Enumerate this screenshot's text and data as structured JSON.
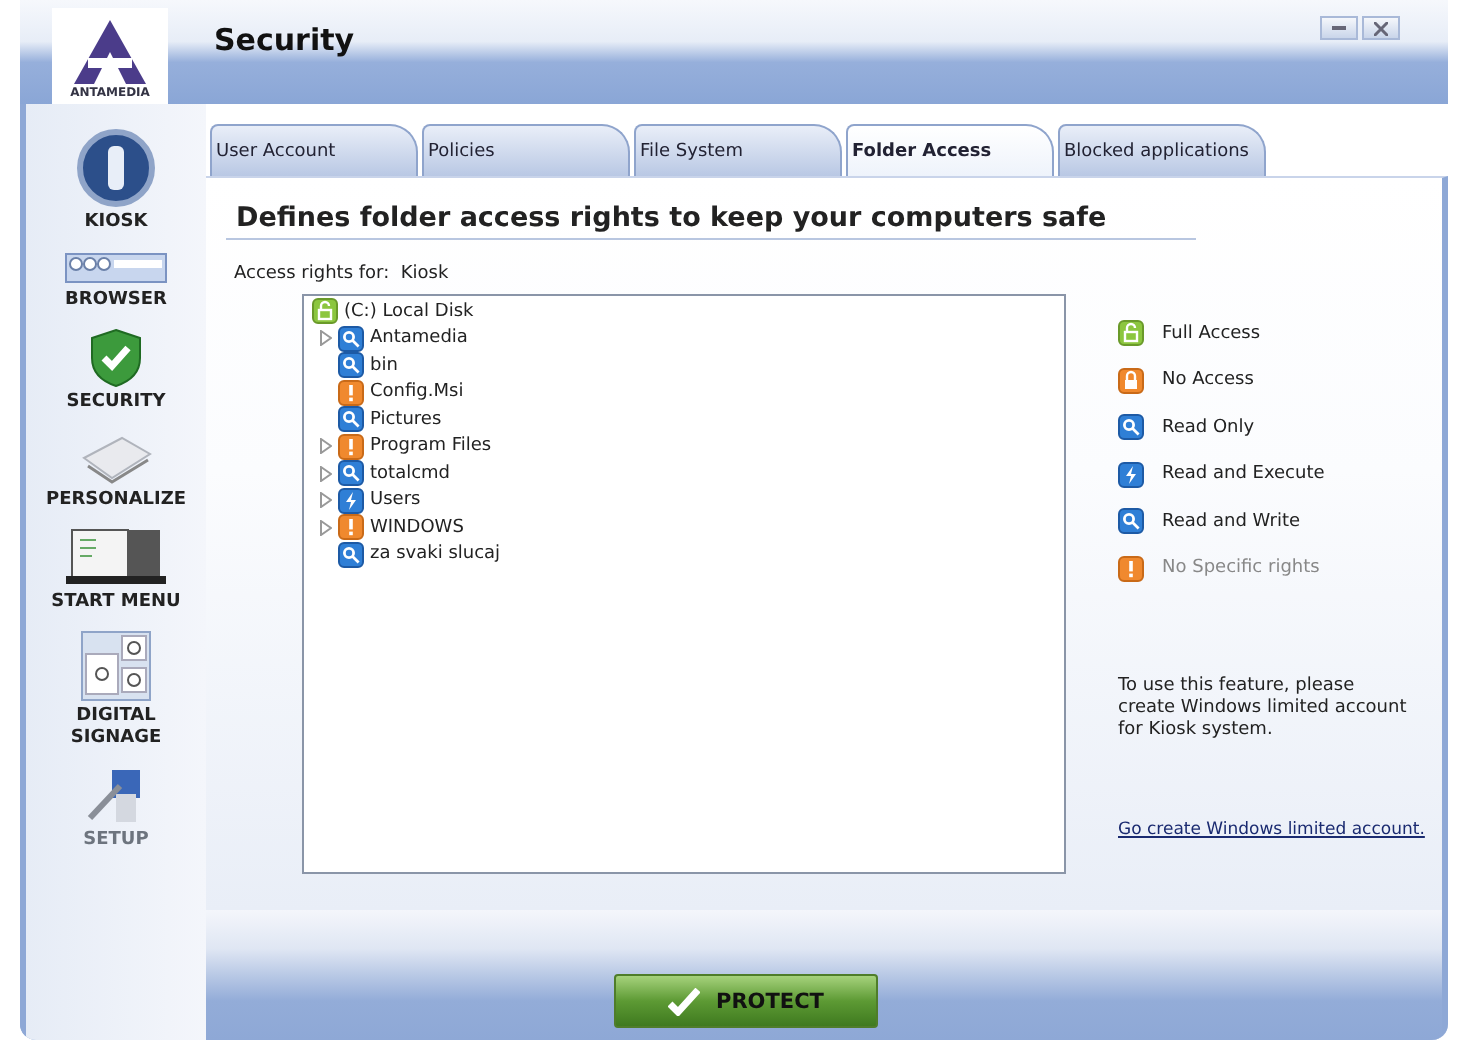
{
  "window": {
    "logo": "ANTAMEDIA",
    "title": "Security"
  },
  "sidebar": {
    "items": [
      {
        "label": "KIOSK",
        "kind": "kiosk",
        "disabled": false
      },
      {
        "label": "BROWSER",
        "kind": "browser",
        "disabled": false
      },
      {
        "label": "SECURITY",
        "kind": "shield",
        "disabled": false
      },
      {
        "label": "PERSONALIZE",
        "kind": "paper",
        "disabled": false
      },
      {
        "label": "START MENU",
        "kind": "monitor",
        "disabled": false
      },
      {
        "label": "DIGITAL SIGNAGE",
        "kind": "signage",
        "disabled": false
      },
      {
        "label": "SETUP",
        "kind": "setup",
        "disabled": true
      }
    ]
  },
  "tabs": [
    {
      "label": "User Account",
      "selected": false
    },
    {
      "label": "Policies",
      "selected": false
    },
    {
      "label": "File System",
      "selected": false
    },
    {
      "label": "Folder Access",
      "selected": true
    },
    {
      "label": "Blocked applications",
      "selected": false
    }
  ],
  "heading": "Defines folder access rights to keep your computers safe",
  "access_for": {
    "label": "Access rights for:",
    "value": "Kiosk"
  },
  "tree": {
    "label": "(C:) Local Disk",
    "kind": "full",
    "children": [
      {
        "label": "Antamedia",
        "kind": "read",
        "expandable": true
      },
      {
        "label": "bin",
        "kind": "read",
        "expandable": false
      },
      {
        "label": "Config.Msi",
        "kind": "unspecified",
        "expandable": false
      },
      {
        "label": "Pictures",
        "kind": "read",
        "expandable": false
      },
      {
        "label": "Program Files",
        "kind": "unspecified",
        "expandable": true
      },
      {
        "label": "totalcmd",
        "kind": "read",
        "expandable": true
      },
      {
        "label": "Users",
        "kind": "execute",
        "expandable": true
      },
      {
        "label": "WINDOWS",
        "kind": "unspecified",
        "expandable": true
      },
      {
        "label": "za svaki slucaj",
        "kind": "write",
        "expandable": false
      }
    ]
  },
  "legend": [
    {
      "label": "Full Access",
      "kind": "full"
    },
    {
      "label": "No Access",
      "kind": "none"
    },
    {
      "label": "Read Only",
      "kind": "read"
    },
    {
      "label": "Read and Execute",
      "kind": "execute"
    },
    {
      "label": "Read and Write",
      "kind": "write"
    },
    {
      "label": "No Specific rights",
      "kind": "unspecified"
    }
  ],
  "note": "To use this feature, please create Windows limited account for Kiosk system.",
  "link": "Go create Windows limited account.",
  "protect_button": "PROTECT"
}
